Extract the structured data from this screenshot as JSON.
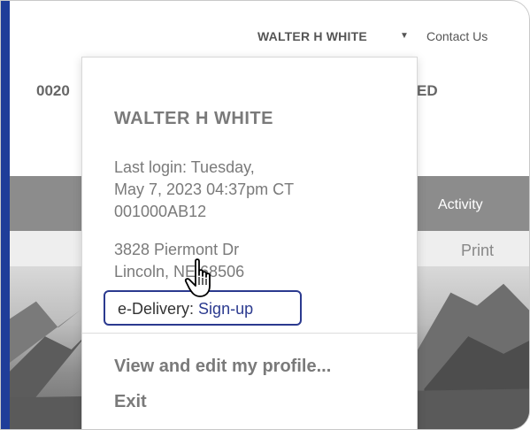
{
  "header": {
    "user_menu_label": "WALTER H WHITE",
    "contact_link": "Contact Us"
  },
  "account": {
    "id_partial": "0020",
    "status_partial": "ED"
  },
  "tabs": {
    "activity_label": "Activity"
  },
  "subbar": {
    "print_label": "Print"
  },
  "dropdown": {
    "name": "WALTER H WHITE",
    "last_login_line1": "Last login:  Tuesday,",
    "last_login_line2": "May 7, 2023 04:37pm CT",
    "account_number": "001000AB12",
    "address_line1": "3828 Piermont Dr",
    "address_line2": "Lincoln, NE 68506",
    "edelivery_label": "e-Delivery:",
    "edelivery_link": "Sign-up",
    "profile_link": "View and edit my profile...",
    "exit_link": "Exit"
  },
  "colors": {
    "brand_blue": "#1f3d99",
    "link_blue": "#2b3a8f",
    "tab_gray": "#8c8c8c"
  },
  "icons": {
    "caret": "caret-down-icon",
    "cursor": "hand-pointer-icon"
  }
}
